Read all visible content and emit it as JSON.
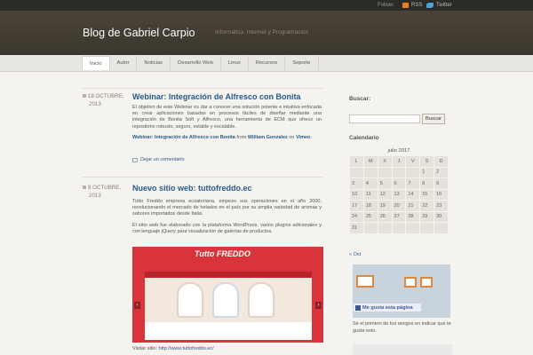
{
  "topbar": {
    "follow": "Follow:",
    "rss": "RSS",
    "twitter": "Twitter"
  },
  "header": {
    "title": "Blog de Gabriel Carpio",
    "description": "Informática, Internet y Programación"
  },
  "nav": [
    "Inicio",
    "Autor",
    "Noticias",
    "Desarrollo Web",
    "Linux",
    "Recursos",
    "Soporte"
  ],
  "posts": [
    {
      "date_day": "18 OCTUBRE,",
      "date_year": "2013",
      "title": "Webinar: Integración de Alfresco con Bonita",
      "body": "El objetivo de este Webinar es dar a conocer una solución potente e intuitiva enfocada en crear aplicaciones basadas en procesos fáciles de diseñar mediante una integración de Bonita Soft y Alfresco, una herramienta de ECM que ofrece un repositorio robusto, seguro, estable y escalable.",
      "video_link": "Webinar: Integración de Alfresco con Bonita",
      "from": "from",
      "author": "William Gonzalez",
      "on": "on",
      "vimeo": "Vimeo",
      "comment": "Dejar un comentario"
    },
    {
      "date_day": "8 OCTUBRE,",
      "date_year": "2013",
      "title": "Nuevo sitio web: tuttofreddo.ec",
      "p1": "Tutto Freddo empresa ecuatoriana, empezo sus operaciones en el año 2000, revolucionando el mercado de helados en el país por su amplia variedad de aromas y sabores importados desde Italia.",
      "p2": "El sitio web fue elaborado con la plataforma WordPress, varios plugins adicionales y con lenguaje jQuery para visualización de galerías de productos.",
      "banner_logo": "Tutto FREDDO",
      "visit_label": "Visitar sitio:",
      "visit_url": "http://www.tuttofreddo.ec/"
    }
  ],
  "sidebar": {
    "search_heading": "Buscar:",
    "search_button": "Buscar",
    "calendar_heading": "Calendario",
    "calendar_caption": "julio 2017",
    "weekdays": [
      "L",
      "M",
      "X",
      "J",
      "V",
      "S",
      "D"
    ],
    "weeks": [
      [
        "",
        "",
        "",
        "",
        "",
        "1",
        "2"
      ],
      [
        "3",
        "4",
        "5",
        "6",
        "7",
        "8",
        "9"
      ],
      [
        "10",
        "11",
        "12",
        "13",
        "14",
        "15",
        "16"
      ],
      [
        "17",
        "18",
        "19",
        "20",
        "21",
        "22",
        "23"
      ],
      [
        "24",
        "25",
        "26",
        "27",
        "28",
        "29",
        "30"
      ],
      [
        "31",
        "",
        "",
        "",
        "",
        "",
        ""
      ]
    ],
    "prev_month": "« Oct",
    "fb_like": "Me gusta esta página",
    "fb_text": "Sé el primero de tus amigos en indicar que te gusta esto."
  },
  "colors": {
    "accent": "#2a5a8a",
    "header": "#3f3a30",
    "topbar": "#2d2b27",
    "banner": "#d9343b"
  }
}
